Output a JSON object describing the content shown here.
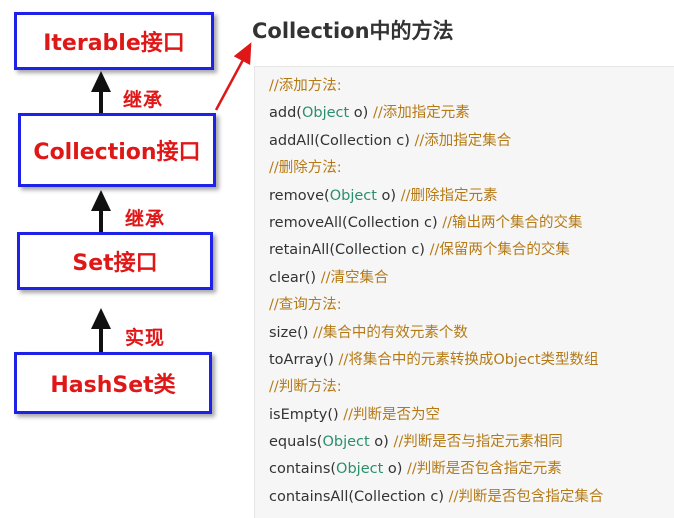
{
  "diagram": {
    "boxes": {
      "iterable": "Iterable接口",
      "collection": "Collection接口",
      "set": "Set接口",
      "hashset": "HashSet类"
    },
    "relations": {
      "iterable_collection": "继承",
      "collection_set": "继承",
      "set_hashset": "实现"
    },
    "colors": {
      "box_border": "#1e22e6",
      "label_text": "#e01717",
      "arrow": "#111111",
      "pointer_arrow": "#e01717"
    }
  },
  "methods": {
    "title": "Collection中的方法",
    "lines": [
      [
        {
          "t": "//添加方法:",
          "c": "comment"
        }
      ],
      [
        {
          "t": "add(",
          "c": "plain"
        },
        {
          "t": "Object",
          "c": "type"
        },
        {
          "t": " o) ",
          "c": "plain"
        },
        {
          "t": "//添加指定元素",
          "c": "comment"
        }
      ],
      [
        {
          "t": "addAll(Collection c) ",
          "c": "plain"
        },
        {
          "t": "//添加指定集合",
          "c": "comment"
        }
      ],
      [
        {
          "t": "//删除方法:",
          "c": "comment"
        }
      ],
      [
        {
          "t": "remove(",
          "c": "plain"
        },
        {
          "t": "Object",
          "c": "type"
        },
        {
          "t": " o) ",
          "c": "plain"
        },
        {
          "t": "//删除指定元素",
          "c": "comment"
        }
      ],
      [
        {
          "t": "removeAll(Collection c) ",
          "c": "plain"
        },
        {
          "t": "//输出两个集合的交集",
          "c": "comment"
        }
      ],
      [
        {
          "t": "retainAll(Collection c) ",
          "c": "plain"
        },
        {
          "t": "//保留两个集合的交集",
          "c": "comment"
        }
      ],
      [
        {
          "t": "clear() ",
          "c": "plain"
        },
        {
          "t": "//清空集合",
          "c": "comment"
        }
      ],
      [
        {
          "t": "//查询方法:",
          "c": "comment"
        }
      ],
      [
        {
          "t": "size() ",
          "c": "plain"
        },
        {
          "t": "//集合中的有效元素个数",
          "c": "comment"
        }
      ],
      [
        {
          "t": "toArray() ",
          "c": "plain"
        },
        {
          "t": "//将集合中的元素转换成Object类型数组",
          "c": "comment"
        }
      ],
      [
        {
          "t": "//判断方法:",
          "c": "comment"
        }
      ],
      [
        {
          "t": "isEmpty() ",
          "c": "plain"
        },
        {
          "t": "//判断是否为空",
          "c": "comment"
        }
      ],
      [
        {
          "t": "equals(",
          "c": "plain"
        },
        {
          "t": "Object",
          "c": "type"
        },
        {
          "t": " o) ",
          "c": "plain"
        },
        {
          "t": "//判断是否与指定元素相同",
          "c": "comment"
        }
      ],
      [
        {
          "t": "contains(",
          "c": "plain"
        },
        {
          "t": "Object",
          "c": "type"
        },
        {
          "t": " o) ",
          "c": "plain"
        },
        {
          "t": "//判断是否包含指定元素",
          "c": "comment"
        }
      ],
      [
        {
          "t": "containsAll(Collection c) ",
          "c": "plain"
        },
        {
          "t": "//判断是否包含指定集合",
          "c": "comment"
        }
      ]
    ],
    "colors": {
      "comment": "#b57a15",
      "type": "#2a8f6a",
      "plain": "#333333",
      "panel_bg": "#f6f6f6"
    }
  }
}
